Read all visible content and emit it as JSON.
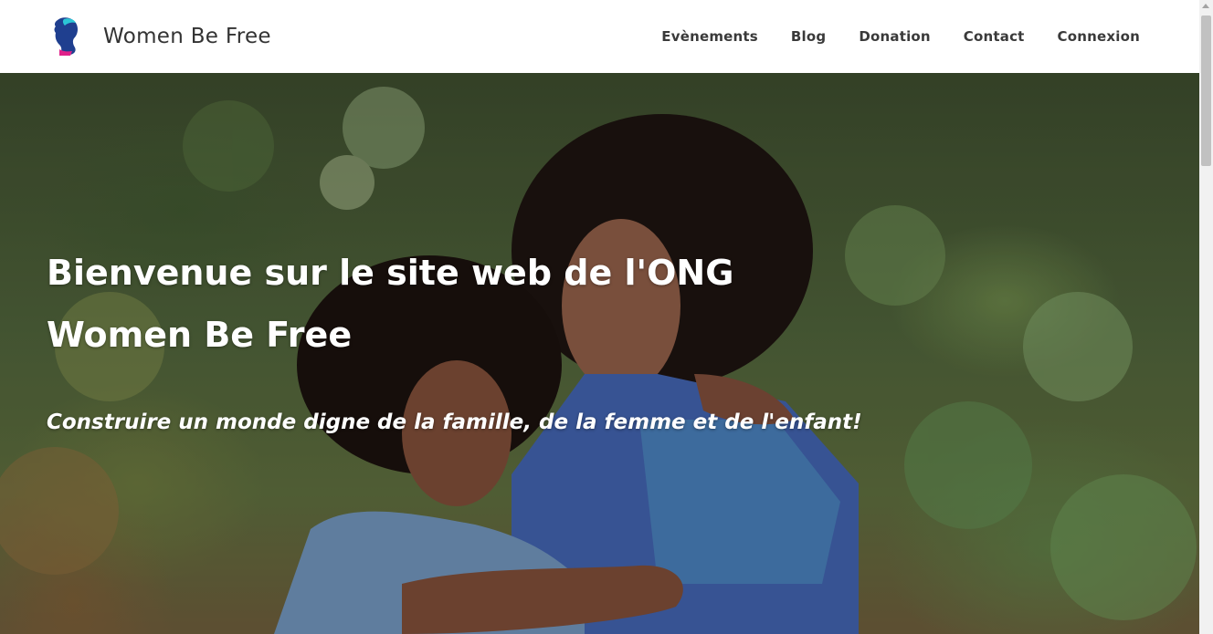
{
  "brand": {
    "logo_icon": "woman-silhouette-icon",
    "name": "Women Be Free"
  },
  "nav": {
    "items": [
      {
        "label": "Evènements"
      },
      {
        "label": "Blog"
      },
      {
        "label": "Donation"
      },
      {
        "label": "Contact"
      },
      {
        "label": "Connexion"
      }
    ]
  },
  "hero": {
    "title_line1": "Bienvenue sur le site web de l'ONG",
    "title_line2": "Women Be Free",
    "subtitle": "Construire un monde digne de la famille, de la femme et de l'enfant!",
    "image": "photo-mother-and-child"
  },
  "colors": {
    "header_bg": "#ffffff",
    "nav_text": "#3a3a3a",
    "hero_text": "#ffffff",
    "logo_primary": "#1f3f8f",
    "logo_accent": "#2cc6d6",
    "logo_pink": "#e0218a"
  }
}
